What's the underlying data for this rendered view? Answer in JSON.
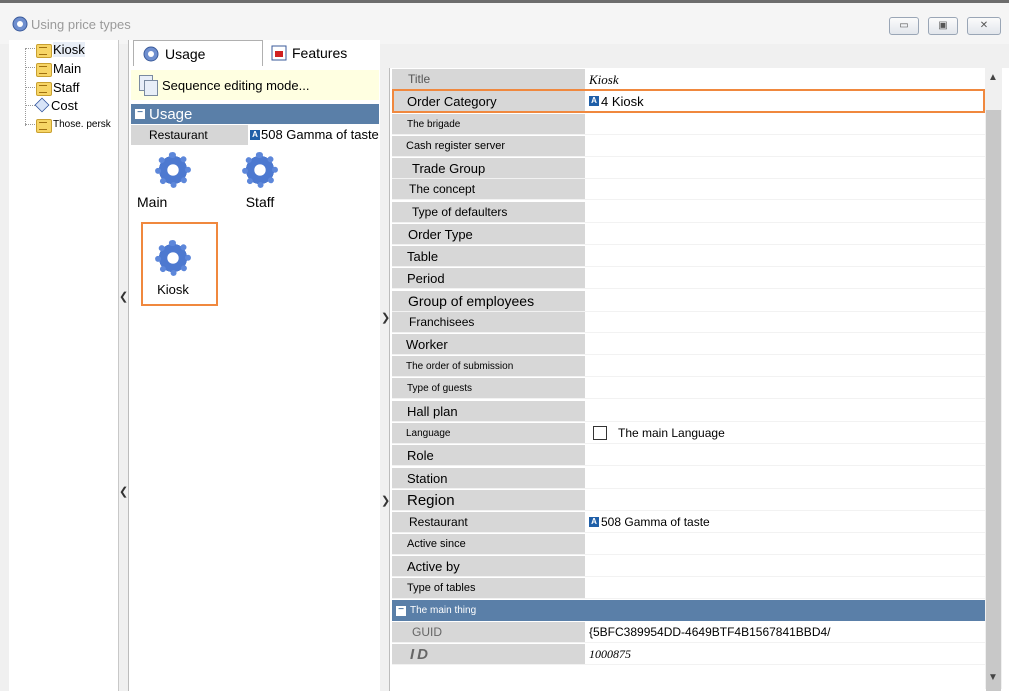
{
  "window": {
    "title": "Using price types",
    "icon": "gear-icon",
    "controls": [
      "minimize-icon",
      "restore-icon",
      "close-icon"
    ]
  },
  "tree": {
    "items": [
      {
        "label": "Kiosk",
        "icon": "folder-icon"
      },
      {
        "label": "Main",
        "icon": "folder-icon"
      },
      {
        "label": "Staff",
        "icon": "folder-icon"
      },
      {
        "label": "Cost",
        "icon": "cost-icon"
      },
      {
        "label": "Those. persk",
        "icon": "folder-icon"
      }
    ]
  },
  "tabs": [
    {
      "label": "Usage",
      "icon": "gear-icon"
    },
    {
      "label": "Features",
      "icon": "features-icon"
    }
  ],
  "sequence_mode": "Sequence editing mode...",
  "usage_group": {
    "header": "Usage",
    "restaurant_label": "Restaurant",
    "restaurant_value": "508 Gamma of taste"
  },
  "tiles": [
    {
      "label": "Main"
    },
    {
      "label": "Staff"
    },
    {
      "label": "Kiosk"
    }
  ],
  "properties": [
    {
      "label": "Title",
      "value": "Kiosk"
    },
    {
      "label": "Order Category",
      "value": "4 Kiosk"
    },
    {
      "label": "The brigade",
      "value": ""
    },
    {
      "label": "Cash register server",
      "value": ""
    },
    {
      "label": "Trade Group",
      "value": ""
    },
    {
      "label": "The concept",
      "value": ""
    },
    {
      "label": "Type of defaulters",
      "value": ""
    },
    {
      "label": "Order Type",
      "value": ""
    },
    {
      "label": "Table",
      "value": ""
    },
    {
      "label": "Period",
      "value": ""
    },
    {
      "label": "Group of employees",
      "value": ""
    },
    {
      "label": "Franchisees",
      "value": ""
    },
    {
      "label": "Worker",
      "value": ""
    },
    {
      "label": "The order of submission",
      "value": ""
    },
    {
      "label": "Type of guests",
      "value": ""
    },
    {
      "label": "Hall plan",
      "value": ""
    },
    {
      "label": "Language",
      "value": "The main Language"
    },
    {
      "label": "Role",
      "value": ""
    },
    {
      "label": "Station",
      "value": ""
    },
    {
      "label": "Region",
      "value": ""
    },
    {
      "label": "Restaurant",
      "value": "508 Gamma of taste"
    },
    {
      "label": "Active since",
      "value": ""
    },
    {
      "label": "Active by",
      "value": ""
    },
    {
      "label": "Type of tables",
      "value": ""
    }
  ],
  "main_group": {
    "header": "The main thing",
    "guid_label": "GUID",
    "guid_value": "{5BFC389954DD-4649BTF4B1567841BBD4/",
    "id_label": "ID",
    "id_value": "1000875"
  }
}
